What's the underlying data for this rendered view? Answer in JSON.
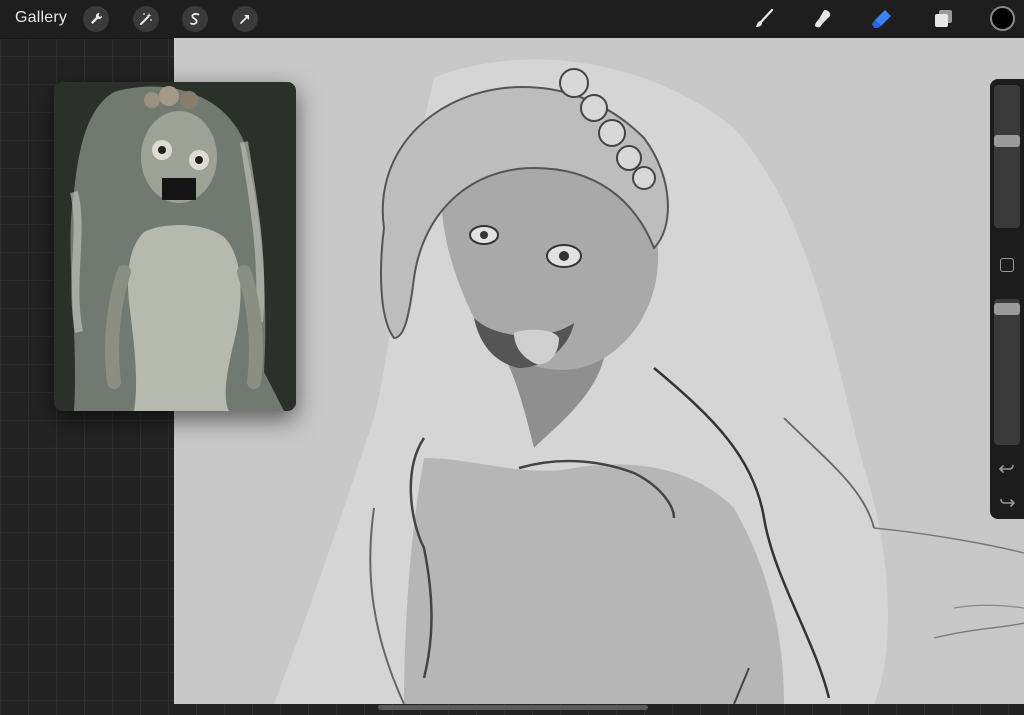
{
  "app": {
    "gallery_label": "Gallery"
  },
  "toolbar": {
    "left_tools": [
      "wrench-icon",
      "magic-wand-icon",
      "selection-icon",
      "transform-arrow-icon"
    ],
    "right_tools": [
      "brush-icon",
      "smudge-icon",
      "eraser-icon",
      "layers-icon"
    ],
    "active_tool": "eraser-icon",
    "active_color": "#3b82f6",
    "current_color": "#000000"
  },
  "sidebar": {
    "brush_size_level": 0.62,
    "opacity_level": 0.97
  }
}
